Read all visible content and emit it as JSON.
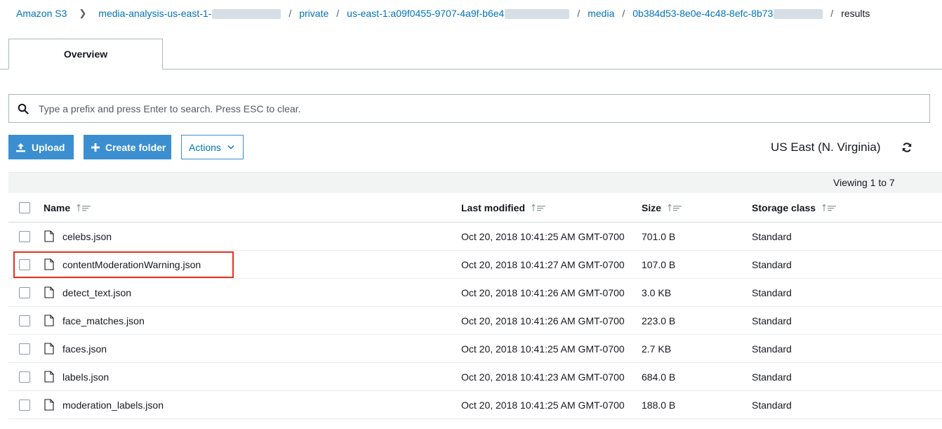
{
  "breadcrumb": {
    "root": "Amazon S3",
    "bucket": "media-analysis-us-east-1-",
    "private": "private",
    "identity": "us-east-1:a09f0455-9707-4a9f-b6e4",
    "media": "media",
    "object": "0b384d53-8e0e-4c48-8efc-8b73",
    "current": "results"
  },
  "tabs": {
    "overview": "Overview"
  },
  "search": {
    "placeholder": "Type a prefix and press Enter to search. Press ESC to clear."
  },
  "toolbar": {
    "upload": "Upload",
    "create_folder": "Create folder",
    "actions": "Actions",
    "region": "US East (N. Virginia)"
  },
  "viewing": "Viewing 1 to 7",
  "columns": {
    "name": "Name",
    "last_modified": "Last modified",
    "size": "Size",
    "storage_class": "Storage class"
  },
  "files": [
    {
      "name": "celebs.json",
      "modified": "Oct 20, 2018 10:41:25 AM GMT-0700",
      "size": "701.0 B",
      "class": "Standard"
    },
    {
      "name": "contentModerationWarning.json",
      "modified": "Oct 20, 2018 10:41:27 AM GMT-0700",
      "size": "107.0 B",
      "class": "Standard"
    },
    {
      "name": "detect_text.json",
      "modified": "Oct 20, 2018 10:41:26 AM GMT-0700",
      "size": "3.0 KB",
      "class": "Standard"
    },
    {
      "name": "face_matches.json",
      "modified": "Oct 20, 2018 10:41:26 AM GMT-0700",
      "size": "223.0 B",
      "class": "Standard"
    },
    {
      "name": "faces.json",
      "modified": "Oct 20, 2018 10:41:25 AM GMT-0700",
      "size": "2.7 KB",
      "class": "Standard"
    },
    {
      "name": "labels.json",
      "modified": "Oct 20, 2018 10:41:23 AM GMT-0700",
      "size": "684.0 B",
      "class": "Standard"
    },
    {
      "name": "moderation_labels.json",
      "modified": "Oct 20, 2018 10:41:25 AM GMT-0700",
      "size": "188.0 B",
      "class": "Standard"
    }
  ],
  "colors": {
    "link": "#0073bb",
    "primary_button": "#3b8fd1",
    "highlight": "#e8301f"
  },
  "icons": [
    "chevron-right-icon",
    "search-icon",
    "upload-icon",
    "plus-icon",
    "chevron-down-icon",
    "refresh-icon",
    "sort-icon",
    "file-icon"
  ]
}
